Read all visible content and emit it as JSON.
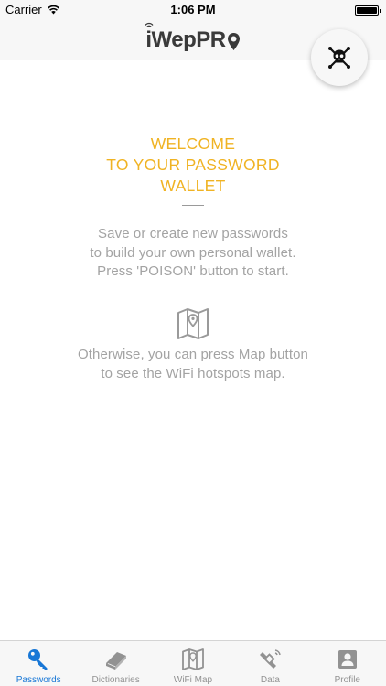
{
  "status_bar": {
    "carrier": "Carrier",
    "time": "1:06 PM"
  },
  "nav": {
    "logo_text": "iWepPR"
  },
  "main": {
    "welcome_lines": [
      "WELCOME",
      "TO YOUR PASSWORD",
      "WALLET"
    ],
    "intro_lines": [
      "Save or create new passwords",
      "to build your own personal wallet.",
      "Press 'POISON' button to start."
    ],
    "map_lines": [
      "Otherwise, you can press Map button",
      "to see the WiFi hotspots map."
    ]
  },
  "tabs": [
    {
      "label": "Passwords",
      "icon": "key-icon",
      "active": true
    },
    {
      "label": "Dictionaries",
      "icon": "book-icon",
      "active": false
    },
    {
      "label": "WiFi Map",
      "icon": "map-icon",
      "active": false
    },
    {
      "label": "Data",
      "icon": "satellite-icon",
      "active": false
    },
    {
      "label": "Profile",
      "icon": "profile-icon",
      "active": false
    }
  ],
  "colors": {
    "accent": "#f0b323",
    "tab_active": "#1877d6",
    "tab_inactive": "#929292",
    "muted_text": "#a3a3a3"
  }
}
